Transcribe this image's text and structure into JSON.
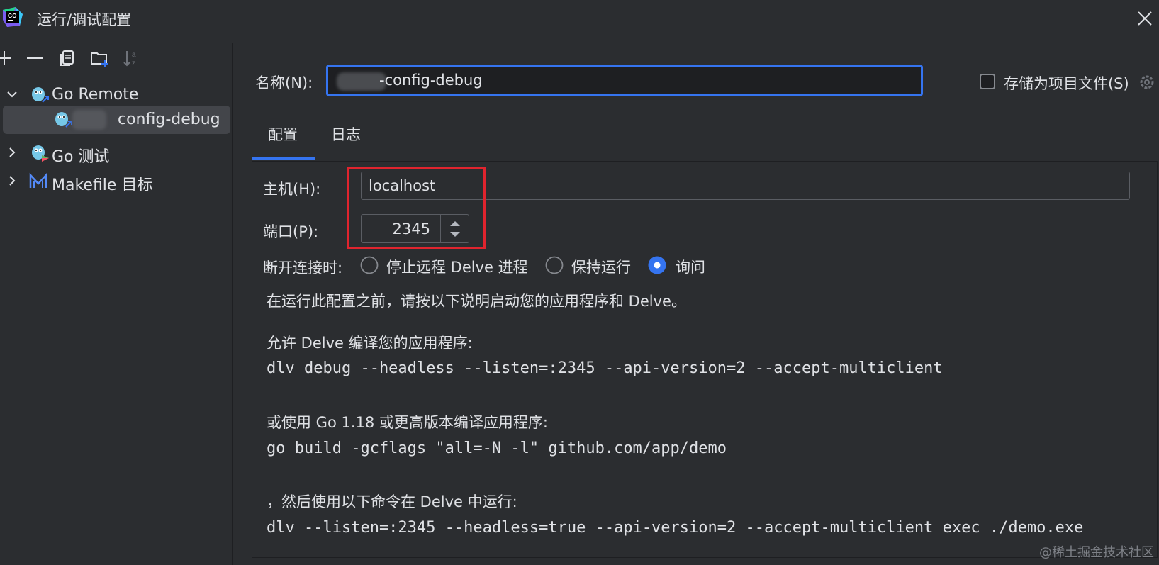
{
  "window": {
    "title": "运行/调试配置"
  },
  "toolbar": {
    "icons": [
      "plus-icon",
      "minus-icon",
      "copy-icon",
      "new-folder-icon",
      "sort-icon"
    ]
  },
  "tree": {
    "go_remote": "Go Remote",
    "config_item": "config-debug",
    "go_test": "Go 测试",
    "makefile": "Makefile 目标"
  },
  "name_row": {
    "label": "名称(N):",
    "value": "-config-debug",
    "store_label": "存储为项目文件(S)",
    "store_checked": false
  },
  "tabs": [
    "配置",
    "日志"
  ],
  "form": {
    "host_label": "主机(H):",
    "host_value": "localhost",
    "port_label": "端口(P):",
    "port_value": "2345",
    "disconnect_label": "断开连接时:",
    "radio_options": [
      "停止远程 Delve 进程",
      "保持运行",
      "询问"
    ],
    "radio_selected": "询问"
  },
  "instructions": {
    "intro": "在运行此配置之前，请按以下说明启动您的应用程序和 Delve。",
    "step1": "允许 Delve 编译您的应用程序:",
    "cmd1": "dlv debug --headless --listen=:2345 --api-version=2 --accept-multiclient",
    "step2": "或使用 Go 1.18 或更高版本编译应用程序:",
    "cmd2": "go build -gcflags \"all=-N -l\" github.com/app/demo",
    "step3": "，然后使用以下命令在 Delve 中运行:",
    "cmd3": "dlv --listen=:2345 --headless=true --api-version=2 --accept-multiclient exec ./demo.exe"
  },
  "watermark": "@稀土掘金技术社区",
  "colors": {
    "accent": "#3574f0",
    "highlight": "#e0242e",
    "background": "#2b2d30"
  }
}
